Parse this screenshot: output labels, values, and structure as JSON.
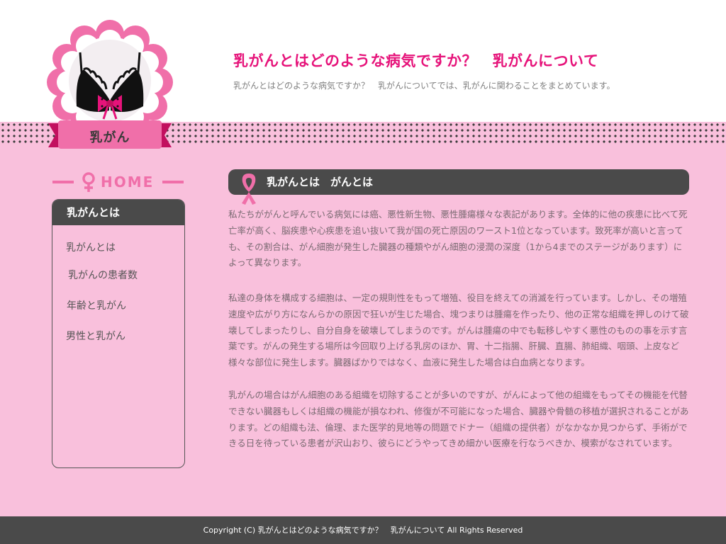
{
  "header": {
    "site_title": "乳がんとはどのような病気ですか？　乳がんについて",
    "site_description": "乳がんとはどのような病気ですか？　乳がんについてでは、乳がんに関わることをまとめています。"
  },
  "logo": {
    "label": "乳がん",
    "icon": "bra-icon"
  },
  "sidebar": {
    "home_label": "HOME",
    "menu_title": "乳がんとは",
    "items": [
      {
        "label": "乳がんとは"
      },
      {
        "label": "乳がんの患者数"
      },
      {
        "label": "年齢と乳がん"
      },
      {
        "label": "男性と乳がん"
      }
    ]
  },
  "content": {
    "heading": "乳がんとは　がんとは",
    "heading_icon": "pink-ribbon-icon",
    "paragraphs": [
      "私たちががんと呼んでいる病気には癌、悪性新生物、悪性腫瘍様々な表記があります。全体的に他の疾患に比べて死亡率が高く、脳疾患や心疾患を追い抜いて我が国の死亡原因のワースト1位となっています。致死率が高いと言っても、その割合は、がん細胞が発生した臓器の種類やがん細胞の浸潤の深度（1から4までのステージがあります）によって異なります。",
      "私達の身体を構成する細胞は、一定の規則性をもって増殖、役目を終えての消滅を行っています。しかし、その増殖速度や広がり方になんらかの原因で狂いが生じた場合、塊つまりは腫瘍を作ったり、他の正常な組織を押しのけて破壊してしまったりし、自分自身を破壊してしまうのです。がんは腫瘍の中でも転移しやすく悪性のものの事を示す言葉です。がんの発生する場所は今回取り上げる乳房のほか、胃、十二指腸、肝臓、直腸、肺組織、咽頭、上皮など様々な部位に発生します。臓器ばかりではなく、血液に発生した場合は白血病となります。",
      "乳がんの場合はがん細胞のある組織を切除することが多いのですが、がんによって他の組織をもってその機能を代替できない臓器もしくは組織の機能が損なわれ、修復が不可能になった場合、臓器や骨髄の移植が選択されることがあります。どの組織も法、倫理、また医学的見地等の問題でドナー（組織の提供者）がなかなか見つからず、手術ができる日を待っている患者が沢山おり、彼らにどうやってきめ細かい医療を行なうべきか、模索がなされています。"
    ]
  },
  "footer": {
    "copyright": "Copyright (C) 乳がんとはどのような病気ですか？　乳がんについて All Rights Reserved"
  },
  "colors": {
    "accent_pink": "#e6137a",
    "background_pink": "#f9c0dc",
    "dark_bar": "#4a4a4a"
  }
}
